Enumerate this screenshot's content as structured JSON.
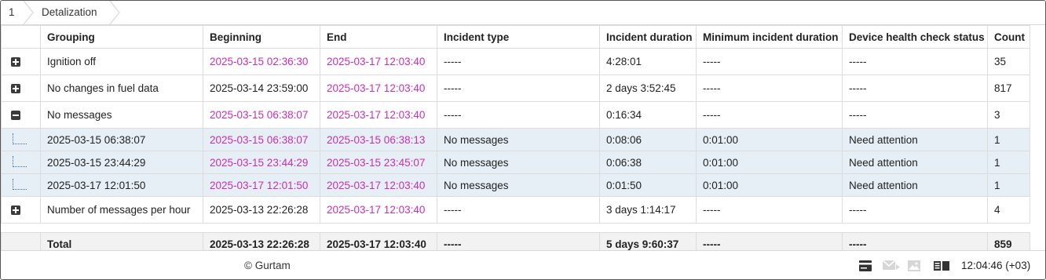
{
  "breadcrumb": {
    "index": "1",
    "tab": "Detalization"
  },
  "columns": [
    "Grouping",
    "Beginning",
    "End",
    "Incident type",
    "Incident duration",
    "Minimum incident duration",
    "Device health check status",
    "Count"
  ],
  "rows": [
    {
      "toggle": "plus",
      "grouping": "Ignition off",
      "beginning": "2025-03-15 02:36:30",
      "beginning_link": true,
      "end": "2025-03-17 12:03:40",
      "incident_type": "-----",
      "duration": "4:28:01",
      "min_duration": "-----",
      "health": "-----",
      "count": "35"
    },
    {
      "toggle": "plus",
      "grouping": "No changes in fuel data",
      "beginning": "2025-03-14 23:59:00",
      "beginning_link": false,
      "end": "2025-03-17 12:03:40",
      "incident_type": "-----",
      "duration": "2 days 3:52:45",
      "min_duration": "-----",
      "health": "-----",
      "count": "817"
    },
    {
      "toggle": "minus",
      "grouping": "No messages",
      "beginning": "2025-03-15 06:38:07",
      "beginning_link": true,
      "end": "2025-03-17 12:03:40",
      "incident_type": "-----",
      "duration": "0:16:34",
      "min_duration": "-----",
      "health": "-----",
      "count": "3"
    }
  ],
  "subrows": [
    {
      "grouping": "2025-03-15 06:38:07",
      "beginning": "2025-03-15 06:38:07",
      "end": "2025-03-15 06:38:13",
      "incident_type": "No messages",
      "duration": "0:08:06",
      "min_duration": "0:01:00",
      "health": "Need attention",
      "count": "1"
    },
    {
      "grouping": "2025-03-15 23:44:29",
      "beginning": "2025-03-15 23:44:29",
      "end": "2025-03-15 23:45:07",
      "incident_type": "No messages",
      "duration": "0:06:38",
      "min_duration": "0:01:00",
      "health": "Need attention",
      "count": "1"
    },
    {
      "grouping": "2025-03-17 12:01:50",
      "beginning": "2025-03-17 12:01:50",
      "end": "2025-03-17 12:03:40",
      "incident_type": "No messages",
      "duration": "0:01:50",
      "min_duration": "0:01:00",
      "health": "Need attention",
      "count": "1"
    }
  ],
  "last_row": {
    "toggle": "plus",
    "grouping": "Number of messages per hour",
    "beginning": "2025-03-13 22:26:28",
    "end": "2025-03-17 12:03:40",
    "incident_type": "-----",
    "duration": "3 days 1:14:17",
    "min_duration": "-----",
    "health": "-----",
    "count": "4"
  },
  "total": {
    "label": "Total",
    "beginning": "2025-03-13 22:26:28",
    "end": "2025-03-17 12:03:40",
    "incident_type": "-----",
    "duration": "5 days 9:60:37",
    "min_duration": "-----",
    "health": "-----",
    "count": "859"
  },
  "footer": {
    "copyright": "© Gurtam",
    "time": "12:04:46 (+03)"
  },
  "icons": [
    "payment-card-icon",
    "mail-icon",
    "image-icon",
    "layout-icon"
  ],
  "colors": {
    "link": "#c72fb7",
    "subrow_bg": "#e6eff5",
    "total_bg": "#f2f2f2"
  }
}
